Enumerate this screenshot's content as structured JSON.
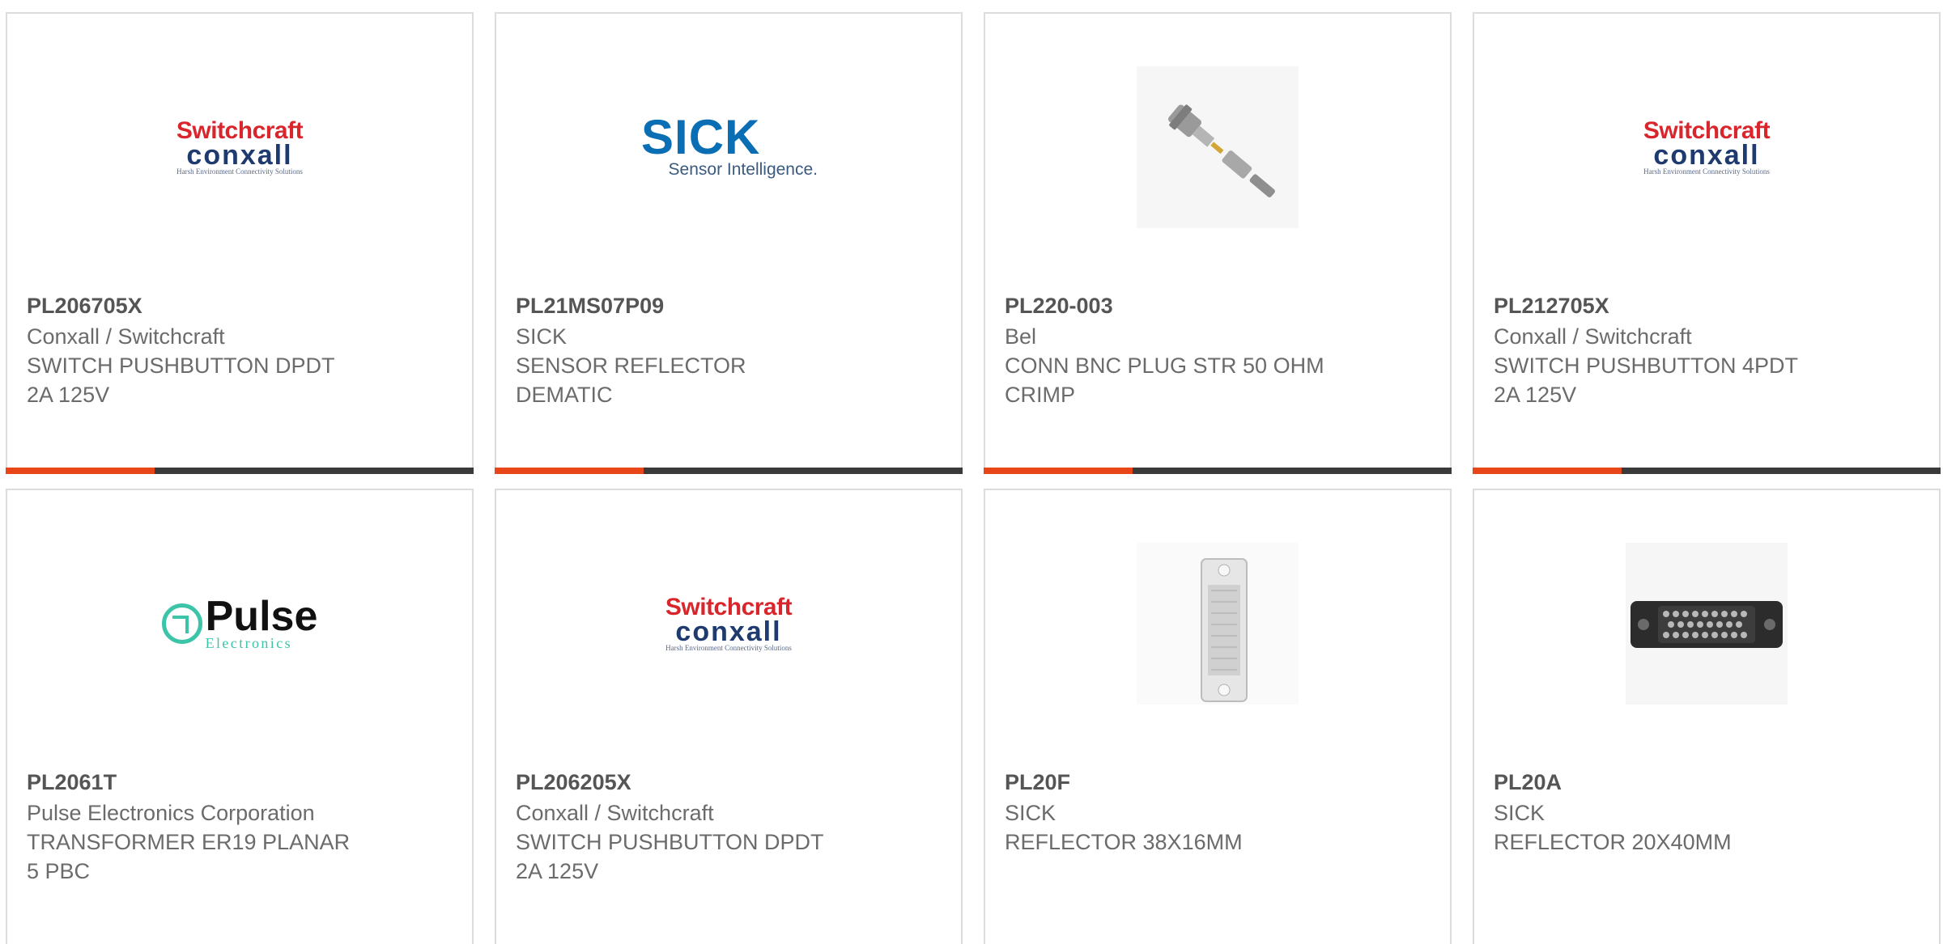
{
  "colors": {
    "accent": "#e84618",
    "bar": "#3a3a3a",
    "border": "#dcdcdc",
    "text": "#6b6b6b"
  },
  "logos": {
    "switchcraft": {
      "top": "Switchcraft",
      "bottom": "conxall",
      "tagline": "Harsh Environment Connectivity Solutions"
    },
    "sick": {
      "big": "SICK",
      "small": "Sensor Intelligence."
    },
    "pulse": {
      "big": "Pulse",
      "small": "Electronics"
    }
  },
  "products": [
    {
      "image": "switchcraft-conxall-logo",
      "part": "PL206705X",
      "manufacturer": "Conxall / Switchcraft",
      "desc1": "SWITCH PUSHBUTTON DPDT",
      "desc2": "2A 125V"
    },
    {
      "image": "sick-logo",
      "part": "PL21MS07P09",
      "manufacturer": "SICK",
      "desc1": "SENSOR REFLECTOR",
      "desc2": "DEMATIC"
    },
    {
      "image": "bnc-connector-photo",
      "part": "PL220-003",
      "manufacturer": "Bel",
      "desc1": "CONN BNC PLUG STR 50 OHM",
      "desc2": "CRIMP"
    },
    {
      "image": "switchcraft-conxall-logo",
      "part": "PL212705X",
      "manufacturer": "Conxall / Switchcraft",
      "desc1": "SWITCH PUSHBUTTON 4PDT",
      "desc2": "2A 125V"
    },
    {
      "image": "pulse-electronics-logo",
      "part": "PL2061T",
      "manufacturer": "Pulse Electronics Corporation",
      "desc1": "TRANSFORMER ER19 PLANAR",
      "desc2": "5 PBC"
    },
    {
      "image": "switchcraft-conxall-logo",
      "part": "PL206205X",
      "manufacturer": "Conxall / Switchcraft",
      "desc1": "SWITCH PUSHBUTTON DPDT",
      "desc2": "2A 125V"
    },
    {
      "image": "reflector-photo",
      "part": "PL20F",
      "manufacturer": "SICK",
      "desc1": "REFLECTOR 38X16MM",
      "desc2": ""
    },
    {
      "image": "connector-block-photo",
      "part": "PL20A",
      "manufacturer": "SICK",
      "desc1": "REFLECTOR 20X40MM",
      "desc2": ""
    }
  ]
}
